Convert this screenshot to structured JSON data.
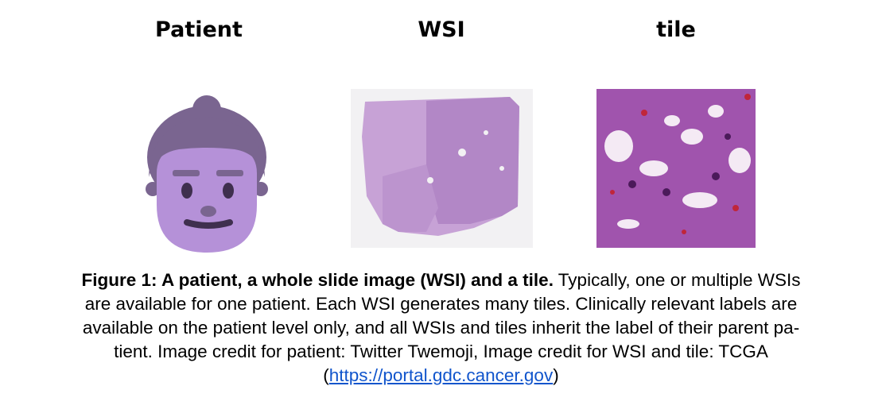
{
  "headers": {
    "patient": "Patient",
    "wsi": "WSI",
    "tile": "tile"
  },
  "caption": {
    "label": "Figure 1: A patient, a whole slide image (WSI) and a tile.",
    "line1_rest": " Typically, one or multiple WSIs",
    "line2": "are available for one patient. Each WSI generates many tiles. Clinically relevant labels are",
    "line3": "available on the patient level only, and all WSIs and tiles inherit the label of their parent pa-",
    "line4": "tient. Image credit for patient: Twitter Twemoji, Image credit for WSI and tile: TCGA",
    "open_paren": "(",
    "link": "https://portal.gdc.cancer.gov",
    "close_paren": ")"
  },
  "colors": {
    "hair": "#7a6590",
    "face": "#b591d8",
    "features": "#3f2f4e",
    "wsi_tissue": "#c7a2d6",
    "tile_background": "#8e3d9a",
    "link": "#1155cc"
  }
}
